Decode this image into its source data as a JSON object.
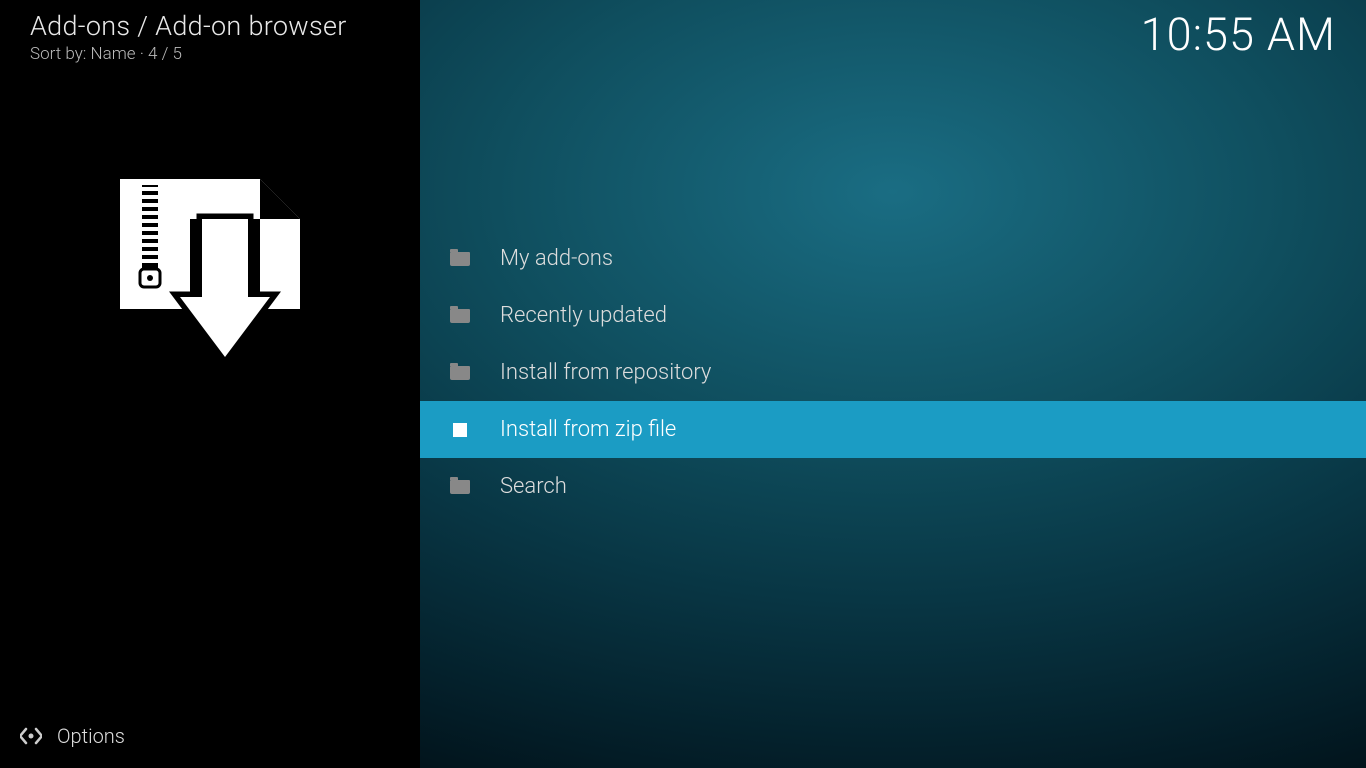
{
  "header": {
    "breadcrumb": "Add-ons / Add-on browser",
    "sort_label": "Sort by: Name  ·  4 / 5"
  },
  "clock": "10:55 AM",
  "menu": {
    "items": [
      {
        "label": "My add-ons",
        "icon": "folder",
        "selected": false
      },
      {
        "label": "Recently updated",
        "icon": "folder",
        "selected": false
      },
      {
        "label": "Install from repository",
        "icon": "folder",
        "selected": false
      },
      {
        "label": "Install from zip file",
        "icon": "zip",
        "selected": true
      },
      {
        "label": "Search",
        "icon": "folder",
        "selected": false
      }
    ]
  },
  "footer": {
    "options_label": "Options"
  }
}
